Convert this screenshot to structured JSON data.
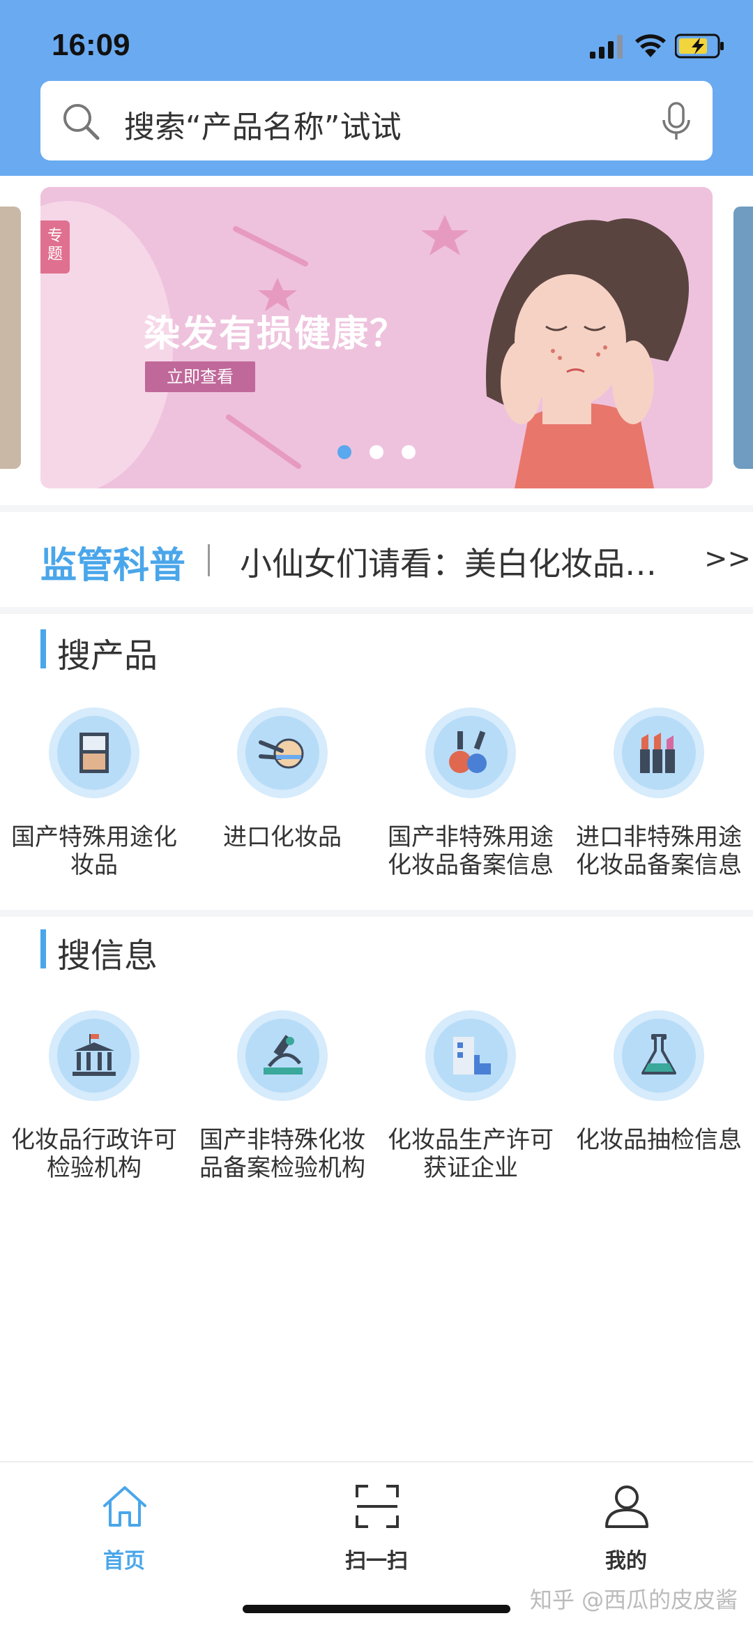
{
  "status_bar": {
    "time": "16:09"
  },
  "search": {
    "placeholder": "搜索“产品名称”试试"
  },
  "banner": {
    "tag": "专题",
    "title": "染发有损健康？",
    "button_label": "立即查看",
    "dots": 3,
    "active_dot": 0
  },
  "ticker": {
    "label": "监管科普",
    "text": "小仙女们请看：美白化妆品…",
    "more": ">>"
  },
  "section_products": {
    "title": "搜产品",
    "items": [
      {
        "label": "国产特殊用途化妆品",
        "icon": "compact-powder-icon"
      },
      {
        "label": "进口化妆品",
        "icon": "makeup-brush-icon"
      },
      {
        "label": "国产非特殊用途化妆品备案信息",
        "icon": "nail-polish-icon"
      },
      {
        "label": "进口非特殊用途化妆品备案信息",
        "icon": "lipstick-icon"
      }
    ]
  },
  "section_info": {
    "title": "搜信息",
    "items": [
      {
        "label": "化妆品行政许可检验机构",
        "icon": "institution-building-icon"
      },
      {
        "label": "国产非特殊化妆品备案检验机构",
        "icon": "microscope-icon"
      },
      {
        "label": "化妆品生产许可获证企业",
        "icon": "factory-icon"
      },
      {
        "label": "化妆品抽检信息",
        "icon": "flask-icon"
      }
    ]
  },
  "tabbar": {
    "items": [
      {
        "label": "首页",
        "icon": "home-icon",
        "active": true
      },
      {
        "label": "扫一扫",
        "icon": "scan-icon",
        "active": false
      },
      {
        "label": "我的",
        "icon": "user-icon",
        "active": false
      }
    ]
  },
  "watermark": "知乎 @西瓜的皮皮酱",
  "colors": {
    "header": "#6aaaf0",
    "accent": "#4aa6ea",
    "icon_bg": "#b7dcf8"
  }
}
